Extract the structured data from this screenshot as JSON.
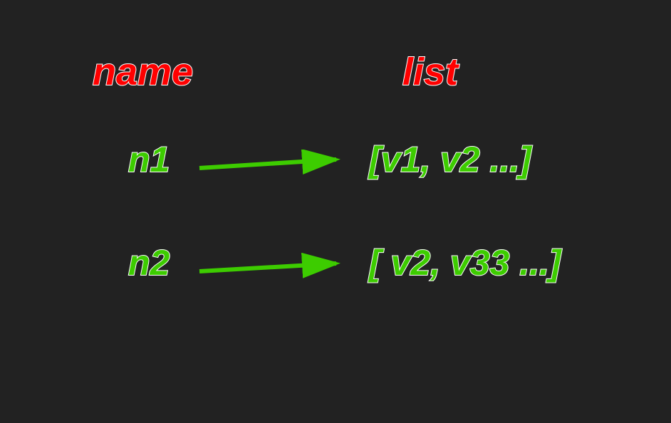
{
  "headers": {
    "name": "name",
    "list": "list"
  },
  "rows": [
    {
      "name": "n1",
      "list_text": "[v1, v2 ...]"
    },
    {
      "name": "n2",
      "list_text": "[ v2, v33 ...]"
    }
  ],
  "colors": {
    "background": "#222222",
    "header_text": "#ff0000",
    "value_text": "#3dcc00",
    "outline": "#ffffff",
    "arrow": "#3dcc00"
  }
}
